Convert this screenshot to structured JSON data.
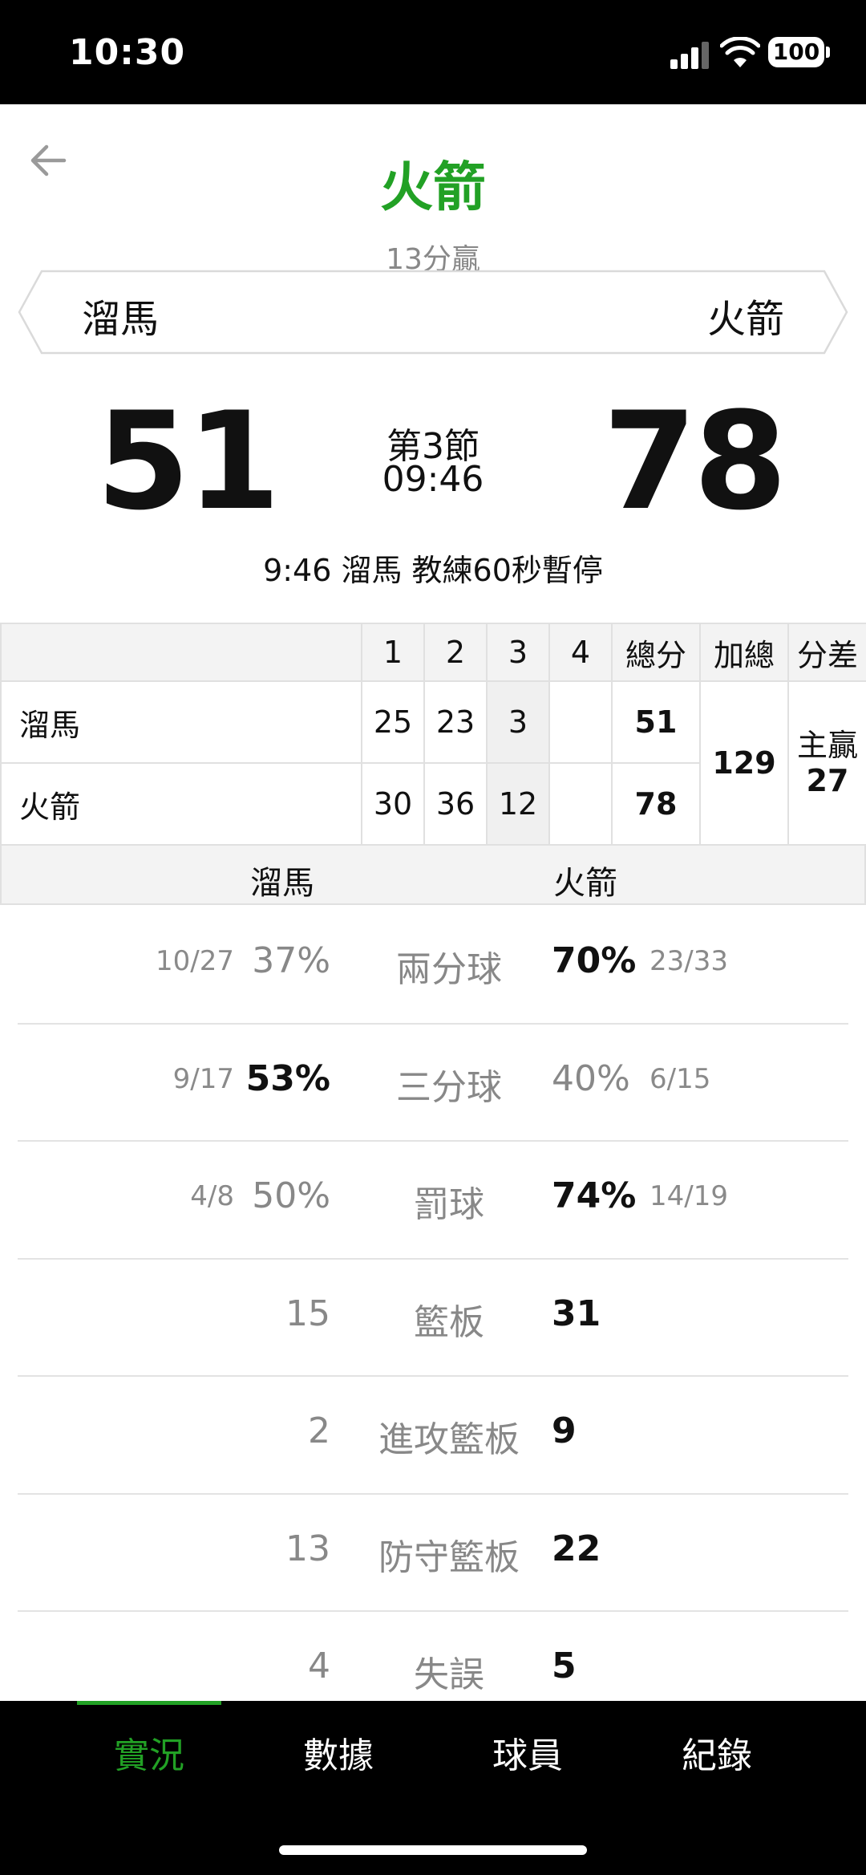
{
  "status_bar": {
    "time": "10:30",
    "battery": "100"
  },
  "header": {
    "title": "火箭",
    "subtitle": "13分贏",
    "away_team": "溜馬",
    "home_team": "火箭"
  },
  "score": {
    "away": "51",
    "home": "78",
    "period": "第3節",
    "clock": "09:46",
    "last_event": "9:46 溜馬  教練60秒暫停"
  },
  "quarter_table": {
    "headers": [
      "",
      "1",
      "2",
      "3",
      "4",
      "總分",
      "加總",
      "分差"
    ],
    "rows": [
      {
        "team": "溜馬",
        "q1": "25",
        "q2": "23",
        "q3": "3",
        "q4": "",
        "total": "51"
      },
      {
        "team": "火箭",
        "q1": "30",
        "q2": "36",
        "q3": "12",
        "q4": "",
        "total": "78"
      }
    ],
    "combined": "129",
    "diff_label": "主贏",
    "diff_value": "27"
  },
  "compare_header": {
    "away": "溜馬",
    "home": "火箭"
  },
  "stats": [
    {
      "label": "兩分球",
      "away_frac": "10/27",
      "away": "37%",
      "home": "70%",
      "home_frac": "23/33"
    },
    {
      "label": "三分球",
      "away_frac": "9/17",
      "away": "53%",
      "home": "40%",
      "home_frac": "6/15"
    },
    {
      "label": "罰球",
      "away_frac": "4/8",
      "away": "50%",
      "home": "74%",
      "home_frac": "14/19"
    },
    {
      "label": "籃板",
      "away_frac": "",
      "away": "15",
      "home": "31",
      "home_frac": ""
    },
    {
      "label": "進攻籃板",
      "away_frac": "",
      "away": "2",
      "home": "9",
      "home_frac": ""
    },
    {
      "label": "防守籃板",
      "away_frac": "",
      "away": "13",
      "home": "22",
      "home_frac": ""
    },
    {
      "label": "失誤",
      "away_frac": "",
      "away": "4",
      "home": "5",
      "home_frac": ""
    }
  ],
  "bottom_nav": {
    "tabs": [
      "實況",
      "數據",
      "球員",
      "紀錄"
    ],
    "active_index": 0
  },
  "colors": {
    "accent": "#22a125",
    "muted": "#888888"
  }
}
